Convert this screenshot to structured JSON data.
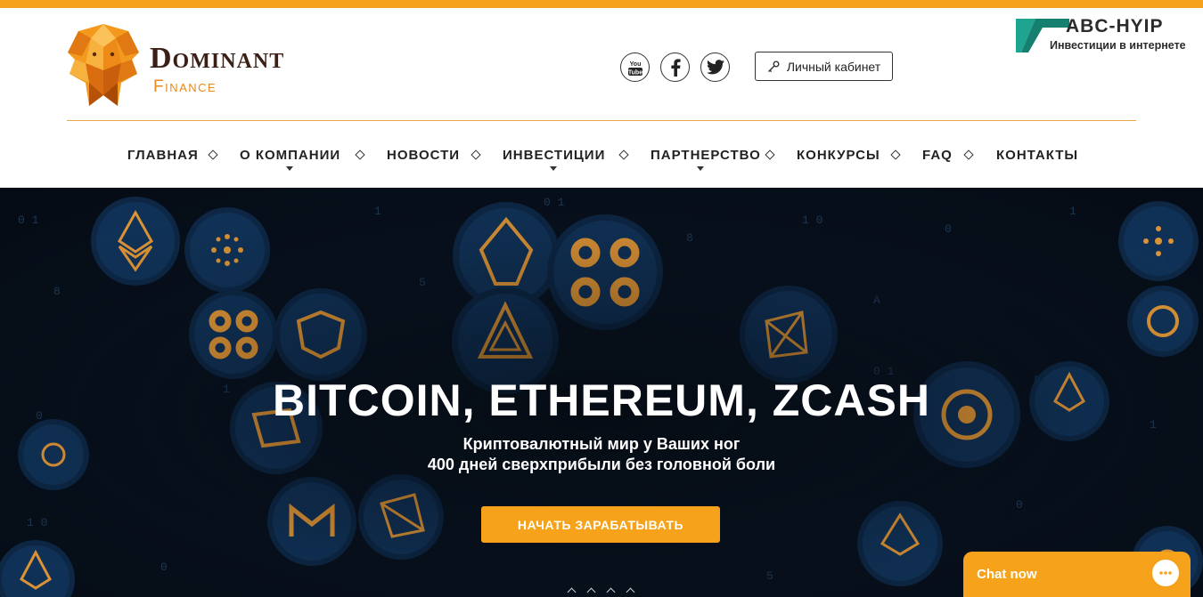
{
  "brand": {
    "name": "Dominant",
    "subtitle": "Finance",
    "logo_icon": "lion-head-logo",
    "accent_color": "#f7a21b",
    "brand_dark": "#3b1f16"
  },
  "social": [
    {
      "name": "youtube-icon",
      "label": "You Tube"
    },
    {
      "name": "facebook-icon",
      "label": "f"
    },
    {
      "name": "twitter-icon",
      "label": "twitter"
    }
  ],
  "account": {
    "label": "Личный кабинет",
    "icon": "key-icon"
  },
  "watermark": {
    "title": "ABC-HYIP",
    "subtitle": "Инвестиции в интернете"
  },
  "nav": [
    {
      "label": "ГЛАВНАЯ",
      "has_dropdown": false
    },
    {
      "label": "О КОМПАНИИ",
      "has_dropdown": true
    },
    {
      "label": "НОВОСТИ",
      "has_dropdown": false
    },
    {
      "label": "ИНВЕСТИЦИИ",
      "has_dropdown": true
    },
    {
      "label": "ПАРТНЕРСТВО",
      "has_dropdown": true
    },
    {
      "label": "КОНКУРСЫ",
      "has_dropdown": false
    },
    {
      "label": "FAQ",
      "has_dropdown": false
    },
    {
      "label": "КОНТАКТЫ",
      "has_dropdown": false
    }
  ],
  "hero": {
    "title": "BITCOIN, ETHEREUM, ZCASH",
    "subtitle_line1": "Криптовалютный мир у Ваших ног",
    "subtitle_line2": "400 дней сверхприбыли без головной боли",
    "cta_label": "НАЧАТЬ ЗАРАБАТЫВАТЬ",
    "background": "crypto-coins-background"
  },
  "chat": {
    "label": "Chat now",
    "icon": "chat-bubble-icon"
  }
}
